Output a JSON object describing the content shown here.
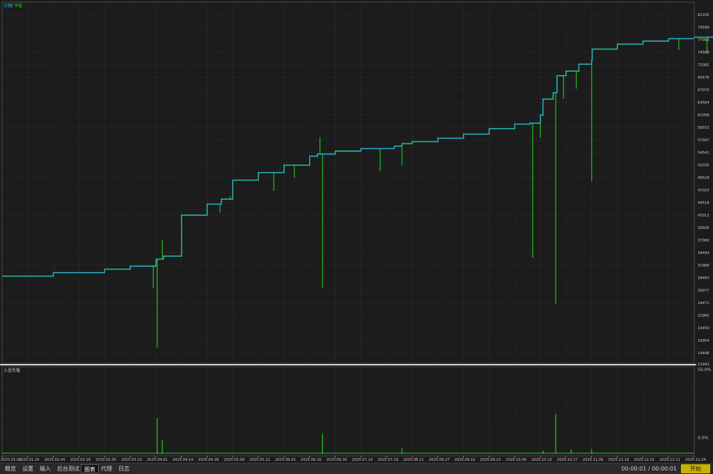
{
  "legend": {
    "balance": "余额",
    "equity": "净值",
    "separator": "/"
  },
  "sub_panel": {
    "title": "入金负载",
    "top_tick": "50.0%",
    "bottom_tick": "0.0%"
  },
  "colors": {
    "background": "#1c1c1c",
    "grid": "#3a3a3a",
    "balance": "#2aa7e0",
    "equity": "#22c41f",
    "load": "#22c41f",
    "axis_text": "#c8c8c8",
    "divider": "#d8d8d8"
  },
  "tabs": [
    {
      "label": "概览",
      "icon": ""
    },
    {
      "label": "设置",
      "icon": ""
    },
    {
      "label": "输入",
      "icon": ""
    },
    {
      "label": "后台测试",
      "icon": ""
    },
    {
      "label": "图表",
      "icon": "chart-icon",
      "active": true
    },
    {
      "label": "代理",
      "icon": ""
    },
    {
      "label": "日志",
      "icon": ""
    }
  ],
  "timer": "00:00:01 / 00:00:01",
  "start_button": "开始",
  "chart_data": {
    "type": "line",
    "title": "",
    "xlabel": "",
    "ylabel": "",
    "y_ticks": [
      "82105",
      "79599",
      "77093",
      "74588",
      "72082",
      "69576",
      "67070",
      "64564",
      "62058",
      "59553",
      "57047",
      "54541",
      "52035",
      "49529",
      "47023",
      "44518",
      "42012",
      "39506",
      "37000",
      "34494",
      "31989",
      "29483",
      "26977",
      "24471",
      "21965",
      "19459",
      "16954",
      "14448",
      "11942"
    ],
    "ylim": [
      11942,
      82105
    ],
    "x_ticks": [
      "2025.01.02",
      "2025.01.20",
      "2025.02.04",
      "2025.02.18",
      "2025.03.05",
      "2025.03.19",
      "2025.04.02",
      "2025.04.14",
      "2025.04.28",
      "2025.05.08",
      "2025.05.21",
      "2025.06.02",
      "2025.06.16",
      "2025.06.30",
      "2025.07.14",
      "2025.07.29",
      "2025.08.11",
      "2025.08.27",
      "2025.09.10",
      "2025.09.23",
      "2025.10.06",
      "2025.10.15",
      "2025.10.27",
      "2025.11.06",
      "2025.11.18",
      "2025.12.01",
      "2025.12.11",
      "2025.12.24"
    ],
    "grid": true,
    "legend_position": "top-left",
    "series": [
      {
        "name": "余额",
        "x": [
          0,
          2,
          4,
          5,
          6,
          6.02,
          6.3,
          7,
          8,
          8.55,
          9,
          10,
          11,
          12,
          12.3,
          13,
          14,
          14.8,
          15.3,
          15.6,
          16,
          17,
          18,
          19,
          20,
          20.6,
          21,
          21.1,
          21.5,
          21.65,
          22,
          22.5,
          23,
          23.02,
          24,
          25,
          26,
          27,
          27.9
        ],
        "values": [
          29800,
          30500,
          31200,
          31800,
          32900,
          33200,
          33800,
          42000,
          44200,
          45200,
          49000,
          50500,
          52000,
          53800,
          54200,
          54800,
          55300,
          55300,
          55800,
          56300,
          56700,
          57400,
          58200,
          59300,
          60200,
          60400,
          62000,
          65200,
          66500,
          69900,
          70800,
          72200,
          73000,
          75200,
          76200,
          76800,
          77300,
          77600,
          78500
        ]
      },
      {
        "name": "净值",
        "x": [
          0,
          2,
          4,
          5,
          6,
          6.02,
          6.3,
          7,
          8,
          8.55,
          9,
          10,
          11,
          12,
          12.3,
          13,
          14,
          14.8,
          15.3,
          15.6,
          16,
          17,
          18,
          19,
          20,
          20.6,
          21,
          21.1,
          21.5,
          21.65,
          22,
          22.5,
          23,
          23.02,
          24,
          25,
          26,
          27,
          27.9
        ],
        "values": [
          29800,
          30500,
          31200,
          31800,
          32900,
          33200,
          33800,
          42000,
          44200,
          45200,
          49000,
          50500,
          52000,
          53800,
          54200,
          54800,
          55300,
          55300,
          55800,
          56300,
          56700,
          57400,
          58200,
          59300,
          60200,
          60400,
          62000,
          65200,
          66500,
          69900,
          70800,
          72200,
          73000,
          75200,
          76200,
          76800,
          77300,
          77600,
          78500
        ],
        "drawdowns": [
          [
            5.9,
            27500
          ],
          [
            6.05,
            15500
          ],
          [
            6.25,
            37000
          ],
          [
            8.5,
            42500
          ],
          [
            8.9,
            45800
          ],
          [
            10.6,
            46900
          ],
          [
            11.4,
            49500
          ],
          [
            12.3,
            53500
          ],
          [
            12.4,
            57600
          ],
          [
            12.5,
            27500
          ],
          [
            14.75,
            50800
          ],
          [
            15.6,
            52000
          ],
          [
            20.7,
            33500
          ],
          [
            21.0,
            57500
          ],
          [
            21.5,
            65300
          ],
          [
            21.6,
            24300
          ],
          [
            21.9,
            65300
          ],
          [
            22.4,
            67300
          ],
          [
            23.0,
            48800
          ],
          [
            26.4,
            75000
          ],
          [
            27.5,
            74600
          ]
        ]
      }
    ],
    "sub_series": {
      "name": "入金负载",
      "ylim": [
        0,
        50
      ],
      "x": [
        6.05,
        6.25,
        12.5,
        15.6,
        21.1,
        21.6,
        22.2,
        23.0
      ],
      "values": [
        20.5,
        8.0,
        11.5,
        3.2,
        1.8,
        23.0,
        2.5,
        2.7
      ]
    }
  }
}
